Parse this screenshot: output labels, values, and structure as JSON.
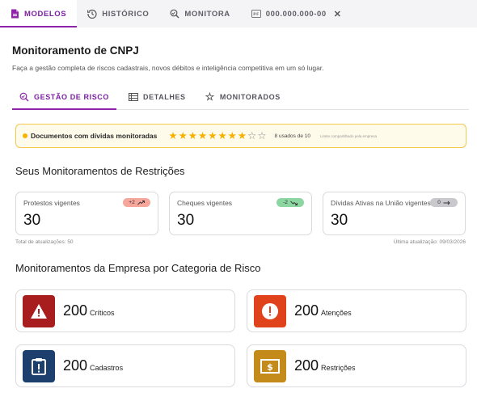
{
  "top_tabs": [
    {
      "label": "MODELOS",
      "icon": "document-icon"
    },
    {
      "label": "HISTÓRICO",
      "icon": "history-icon"
    },
    {
      "label": "MONITORA",
      "icon": "monitor-search-icon"
    },
    {
      "label": "000.000.000-00",
      "icon": "id-card-icon"
    }
  ],
  "page": {
    "title": "Monitoramento de CNPJ",
    "subtitle": "Faça a gestão completa de riscos cadastrais, novos débitos e inteligência competitiva em um só lugar."
  },
  "sub_tabs": [
    {
      "label": "GESTÃO DE RISCO",
      "icon": "monitor-search-icon"
    },
    {
      "label": "DETALHES",
      "icon": "list-icon"
    },
    {
      "label": "MONITORADOS",
      "icon": "star-outline-icon"
    }
  ],
  "banner": {
    "text": "Documentos com dívidas monitoradas",
    "stars_filled": 8,
    "stars_total": 10,
    "used": "8 usados de 10",
    "limit": "Limite compartilhado pela empresa"
  },
  "restrictions": {
    "title": "Seus Monitoramentos de Restrições",
    "cards": [
      {
        "label": "Protestos vigentes",
        "value": "30",
        "badge": "+2",
        "trend": "trend-up-icon"
      },
      {
        "label": "Cheques vigentes",
        "value": "30",
        "badge": "-2",
        "trend": "trend-down-icon"
      },
      {
        "label": "Dívidas Ativas na União vigentes",
        "value": "30",
        "badge": "0",
        "trend": "arrow-right-icon"
      }
    ],
    "total": "Total de atualizações: 50",
    "last_update": "Última atualização: 09/03/2026"
  },
  "categories": {
    "title": "Monitoramentos da Empresa por Categoria de Risco",
    "cards": [
      {
        "value": "200",
        "label": "Críticos",
        "icon": "warning-triangle-icon",
        "color": "#a81e1e"
      },
      {
        "value": "200",
        "label": "Atenções",
        "icon": "alert-circle-icon",
        "color": "#e0431c"
      },
      {
        "value": "200",
        "label": "Cadastros",
        "icon": "clipboard-alert-icon",
        "color": "#1c3f6e"
      },
      {
        "value": "200",
        "label": "Restrições",
        "icon": "money-icon",
        "color": "#c48a1a"
      }
    ]
  },
  "colors": {
    "accent": "#8e24aa",
    "banner_border": "#f2c94c",
    "star": "#f6b100",
    "badge_up": "#f6a69a",
    "badge_down": "#8bd6a1",
    "badge_neutral": "#c9c9cd"
  }
}
